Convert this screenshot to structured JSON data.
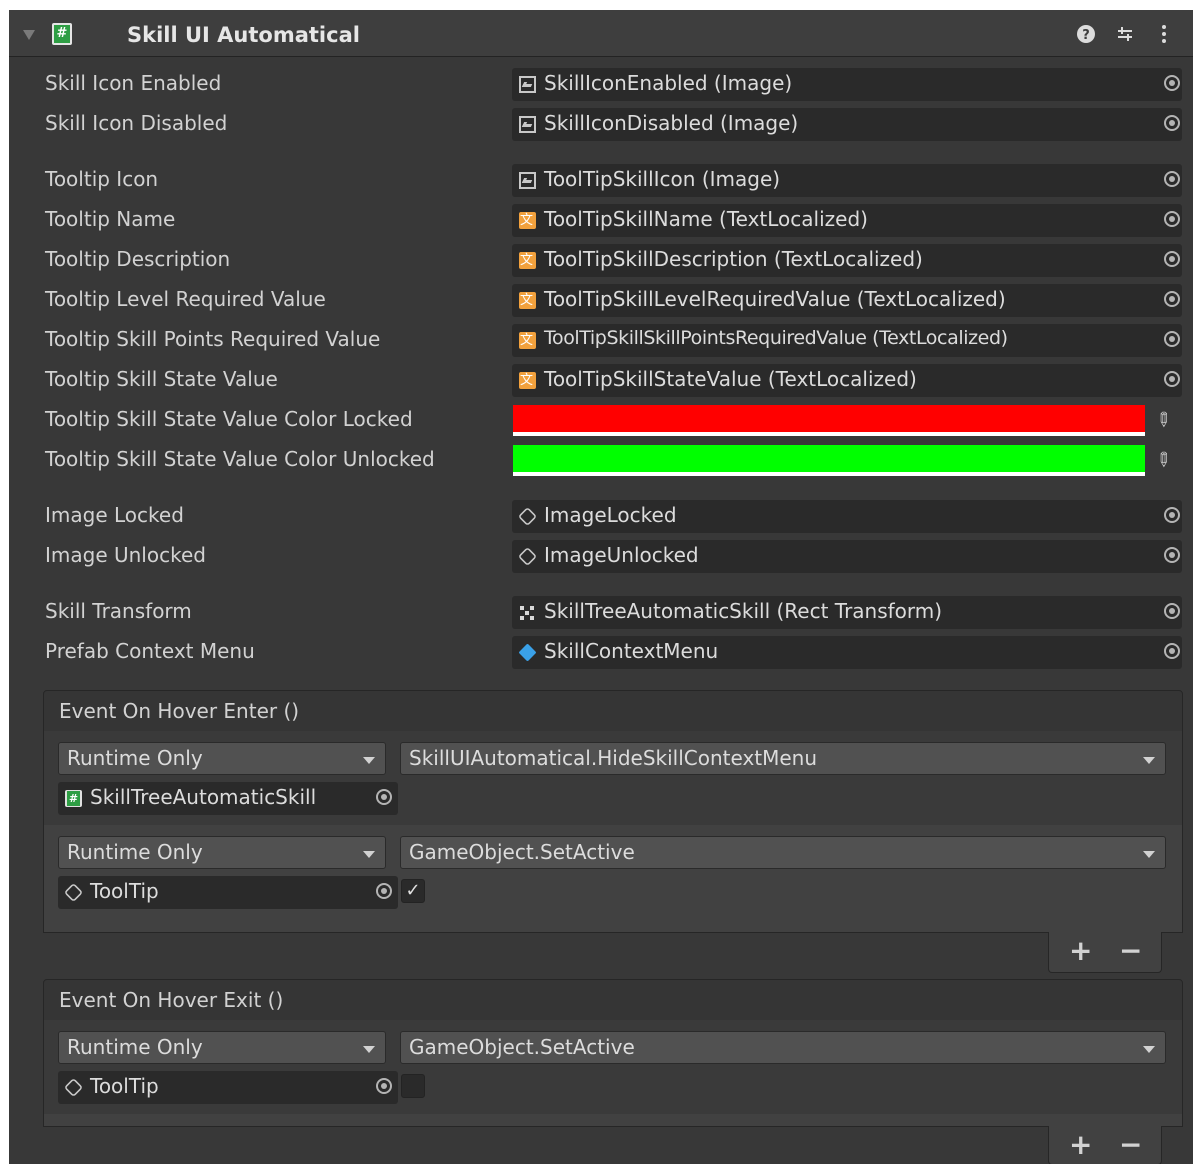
{
  "component": {
    "title": "Skill UI Automatical",
    "icons": [
      "help-icon",
      "presets-icon",
      "more-vertical-icon"
    ]
  },
  "fields": [
    {
      "label": "Skill Icon Enabled",
      "value": "SkillIconEnabled (Image)",
      "icon": "image-icon"
    },
    {
      "label": "Skill Icon Disabled",
      "value": "SkillIconDisabled (Image)",
      "icon": "image-icon"
    },
    {
      "label": "Tooltip Icon",
      "value": "ToolTipSkillIcon (Image)",
      "icon": "image-icon"
    },
    {
      "label": "Tooltip Name",
      "value": "ToolTipSkillName (TextLocalized)",
      "icon": "text-localized-icon"
    },
    {
      "label": "Tooltip Description",
      "value": "ToolTipSkillDescription (TextLocalized)",
      "icon": "text-localized-icon"
    },
    {
      "label": "Tooltip Level Required Value",
      "value": "ToolTipSkillLevelRequiredValue (TextLocalized)",
      "icon": "text-localized-icon"
    },
    {
      "label": "Tooltip Skill Points Required Value",
      "value": "ToolTipSkillSkillPointsRequiredValue (TextLocalized)",
      "icon": "text-localized-icon"
    },
    {
      "label": "Tooltip Skill State Value",
      "value": "ToolTipSkillStateValue (TextLocalized)",
      "icon": "text-localized-icon"
    },
    {
      "label": "Tooltip Skill State Value Color Locked",
      "color": "#ff0000"
    },
    {
      "label": "Tooltip Skill State Value Color Unlocked",
      "color": "#00ff00"
    },
    {
      "label": "Image Locked",
      "value": "ImageLocked",
      "icon": "gameobject-icon"
    },
    {
      "label": "Image Unlocked",
      "value": "ImageUnlocked",
      "icon": "gameobject-icon"
    },
    {
      "label": "Skill Transform",
      "value": "SkillTreeAutomaticSkill (Rect Transform)",
      "icon": "rect-transform-icon"
    },
    {
      "label": "Prefab Context Menu",
      "value": "SkillContextMenu",
      "icon": "prefab-icon"
    }
  ],
  "events": [
    {
      "title": "Event On Hover Enter ()",
      "listeners": [
        {
          "mode": "Runtime Only",
          "function": "SkillUIAutomatical.HideSkillContextMenu",
          "target": "SkillTreeAutomaticSkill",
          "target_icon": "script-icon"
        },
        {
          "mode": "Runtime Only",
          "function": "GameObject.SetActive",
          "target": "ToolTip",
          "target_icon": "gameobject-icon",
          "checked": true
        }
      ],
      "add_label": "+",
      "remove_label": "−"
    },
    {
      "title": "Event On Hover Exit ()",
      "listeners": [
        {
          "mode": "Runtime Only",
          "function": "GameObject.SetActive",
          "target": "ToolTip",
          "target_icon": "gameobject-icon",
          "checked": false
        }
      ],
      "add_label": "+",
      "remove_label": "−"
    }
  ],
  "check_mark": "✓"
}
